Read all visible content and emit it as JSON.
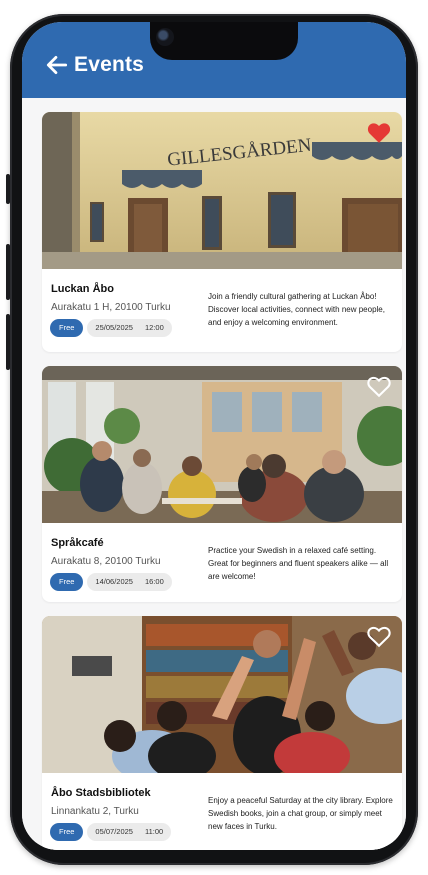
{
  "app": {
    "title": "Events",
    "colors": {
      "accent": "#2f6ab0",
      "favorite": "#e53935"
    }
  },
  "events": [
    {
      "name": "Luckan Åbo",
      "address": "Aurakatu 1 H, 20100 Turku",
      "price_tag": "Free",
      "date": "25/05/2025",
      "time": "12:00",
      "description": "Join a friendly cultural gathering at Luckan Åbo! Discover local activities, connect with new people, and enjoy a welcoming environment.",
      "favorited": true,
      "image_sign": "GILLESGÅRDEN"
    },
    {
      "name": "Språkcafé",
      "address": "Aurakatu 8, 20100 Turku",
      "price_tag": "Free",
      "date": "14/06/2025",
      "time": "16:00",
      "description": "Practice your Swedish in a relaxed café setting. Great for beginners and fluent speakers alike — all are welcome!",
      "favorited": false
    },
    {
      "name": "Åbo Stadsbibliotek",
      "address": "Linnankatu 2, Turku",
      "price_tag": "Free",
      "date": "05/07/2025",
      "time": "11:00",
      "description": "Enjoy a peaceful Saturday at the city library. Explore Swedish books, join a chat group, or simply meet new faces in Turku.",
      "favorited": false
    }
  ]
}
